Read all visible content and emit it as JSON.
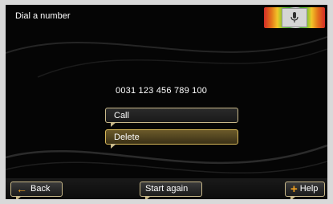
{
  "header": {
    "title": "Dial a number"
  },
  "voice": {
    "icon": "microphone-icon"
  },
  "dialer": {
    "number": "0031 123 456 789 100"
  },
  "menu": {
    "call_label": "Call",
    "delete_label": "Delete"
  },
  "footer": {
    "back_label": "Back",
    "start_again_label": "Start again",
    "help_label": "Help"
  },
  "colors": {
    "accent": "#f0a020",
    "button_border": "#c9b98a",
    "selected_button": "#6b5a2a"
  }
}
